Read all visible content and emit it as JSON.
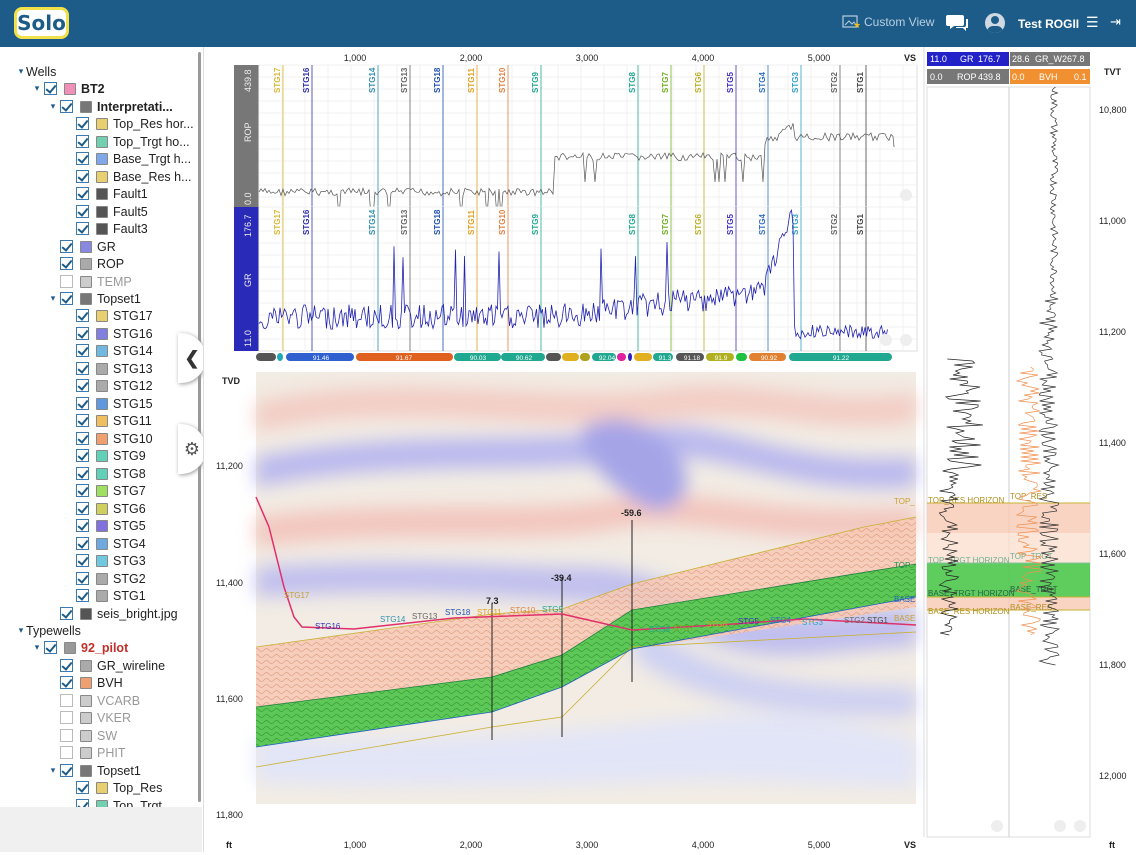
{
  "header": {
    "logo": "Solo",
    "custom_view": "Custom View",
    "user": "Test ROGII"
  },
  "tree": {
    "items": [
      {
        "label": "Wells",
        "level": 0,
        "toggle": "▾",
        "check": "none",
        "color": ""
      },
      {
        "label": "BT2",
        "level": 1,
        "toggle": "▾",
        "check": "on",
        "color": "#f090b8",
        "style": "bold"
      },
      {
        "label": "Interpretati...",
        "level": 2,
        "toggle": "▾",
        "check": "on",
        "color": "#777",
        "style": "bold"
      },
      {
        "label": "Top_Res hor...",
        "level": 3,
        "check": "on",
        "color": "#e8d070"
      },
      {
        "label": "Top_Trgt ho...",
        "level": 3,
        "check": "on",
        "color": "#70d0b0"
      },
      {
        "label": "Base_Trgt h...",
        "level": 3,
        "check": "on",
        "color": "#80a8e8"
      },
      {
        "label": "Base_Res h...",
        "level": 3,
        "check": "on",
        "color": "#e8d070"
      },
      {
        "label": "Fault1",
        "level": 3,
        "check": "on",
        "color": "#555"
      },
      {
        "label": "Fault5",
        "level": 3,
        "check": "on",
        "color": "#555"
      },
      {
        "label": "Fault3",
        "level": 3,
        "check": "on",
        "color": "#555"
      },
      {
        "label": "GR",
        "level": 2,
        "check": "on",
        "color": "#8888e0"
      },
      {
        "label": "ROP",
        "level": 2,
        "check": "on",
        "color": "#aaa"
      },
      {
        "label": "TEMP",
        "level": 2,
        "check": "off",
        "color": "#ccc",
        "style": "grey"
      },
      {
        "label": "Topset1",
        "level": 2,
        "toggle": "▾",
        "check": "on",
        "color": "#777"
      },
      {
        "label": "STG17",
        "level": 3,
        "check": "on",
        "color": "#e8d070"
      },
      {
        "label": "STG16",
        "level": 3,
        "check": "on",
        "color": "#8080e0"
      },
      {
        "label": "STG14",
        "level": 3,
        "check": "on",
        "color": "#70b8e0"
      },
      {
        "label": "STG13",
        "level": 3,
        "check": "on",
        "color": "#aaa"
      },
      {
        "label": "STG12",
        "level": 3,
        "check": "on",
        "color": "#aaa"
      },
      {
        "label": "STG15",
        "level": 3,
        "check": "on",
        "color": "#6098e0"
      },
      {
        "label": "STG11",
        "level": 3,
        "check": "on",
        "color": "#f0c060"
      },
      {
        "label": "STG10",
        "level": 3,
        "check": "on",
        "color": "#f0a070"
      },
      {
        "label": "STG9",
        "level": 3,
        "check": "on",
        "color": "#60d0b8"
      },
      {
        "label": "STG8",
        "level": 3,
        "check": "on",
        "color": "#60d0b8"
      },
      {
        "label": "STG7",
        "level": 3,
        "check": "on",
        "color": "#a0e060"
      },
      {
        "label": "STG6",
        "level": 3,
        "check": "on",
        "color": "#d0d060"
      },
      {
        "label": "STG5",
        "level": 3,
        "check": "on",
        "color": "#8070e0"
      },
      {
        "label": "STG4",
        "level": 3,
        "check": "on",
        "color": "#70a8e0"
      },
      {
        "label": "STG3",
        "level": 3,
        "check": "on",
        "color": "#70c8e0"
      },
      {
        "label": "STG2",
        "level": 3,
        "check": "on",
        "color": "#aaa"
      },
      {
        "label": "STG1",
        "level": 3,
        "check": "on",
        "color": "#aaa"
      },
      {
        "label": "seis_bright.jpg",
        "level": 2,
        "check": "on",
        "color": "#555"
      },
      {
        "label": "Typewells",
        "level": 0,
        "toggle": "▾",
        "check": "none",
        "color": ""
      },
      {
        "label": "92_pilot",
        "level": 1,
        "toggle": "▾",
        "check": "on",
        "color": "#999",
        "style": "red"
      },
      {
        "label": "GR_wireline",
        "level": 2,
        "check": "on",
        "color": "#aaa"
      },
      {
        "label": "BVH",
        "level": 2,
        "check": "on",
        "color": "#f0a070"
      },
      {
        "label": "VCARB",
        "level": 2,
        "check": "off",
        "color": "#ccc",
        "style": "grey"
      },
      {
        "label": "VKER",
        "level": 2,
        "check": "off",
        "color": "#ccc",
        "style": "grey"
      },
      {
        "label": "SW",
        "level": 2,
        "check": "off",
        "color": "#ccc",
        "style": "grey"
      },
      {
        "label": "PHIT",
        "level": 2,
        "check": "off",
        "color": "#ccc",
        "style": "grey"
      },
      {
        "label": "Topset1",
        "level": 2,
        "toggle": "▾",
        "check": "on",
        "color": "#777"
      },
      {
        "label": "Top_Res",
        "level": 3,
        "check": "on",
        "color": "#e8d070"
      },
      {
        "label": "Top_Trgt",
        "level": 3,
        "check": "on",
        "color": "#70d0b0"
      }
    ]
  },
  "vs_axis": {
    "ticks": [
      "1,000",
      "2,000",
      "3,000",
      "4,000",
      "5,000"
    ],
    "unit": "VS"
  },
  "rop": {
    "label": "ROP",
    "max": "439.8",
    "min": "0.0"
  },
  "gr": {
    "label": "GR",
    "max": "176.7",
    "min": "11.0"
  },
  "stages": [
    {
      "name": "STG17",
      "color": "#d8b830"
    },
    {
      "name": "STG16",
      "color": "#3030b0"
    },
    {
      "name": "STG14",
      "color": "#3090b0"
    },
    {
      "name": "STG13",
      "color": "#666"
    },
    {
      "name": "STG18",
      "color": "#2050b0"
    },
    {
      "name": "STG11",
      "color": "#e0a020"
    },
    {
      "name": "STG10",
      "color": "#e08040"
    },
    {
      "name": "STG9",
      "color": "#20a890"
    },
    {
      "name": "STG8",
      "color": "#20a890"
    },
    {
      "name": "STG7",
      "color": "#70b020"
    },
    {
      "name": "STG6",
      "color": "#b8b020"
    },
    {
      "name": "STG5",
      "color": "#4030c0"
    },
    {
      "name": "STG4",
      "color": "#3070c0"
    },
    {
      "name": "STG3",
      "color": "#30a0c8"
    },
    {
      "name": "STG2",
      "color": "#666"
    },
    {
      "name": "STG1",
      "color": "#444"
    }
  ],
  "dip_bar": [
    "91.46",
    "91.67",
    "90.03",
    "90.62",
    "92.04",
    "91.3",
    "91.18",
    "91.9",
    "90.92",
    "91.22"
  ],
  "tvd": {
    "label": "TVD",
    "ticks": [
      "11,200",
      "11,400",
      "11,600",
      "11,800"
    ],
    "unit": "ft"
  },
  "throws": [
    "7.3",
    "-39.4",
    "-59.6"
  ],
  "section_labels": {
    "top": "TOP_",
    "top2": "TOP_",
    "base": "BASE",
    "base2": "BASE",
    "stg17": "STG17"
  },
  "typewell": {
    "gr_label": "GR",
    "gr_max": "176.7",
    "gr_min": "11.0",
    "gr_w_label": "GR_W",
    "gr_w_max": "267.8",
    "gr_w_min": "28.6",
    "rop_label": "ROP",
    "rop_max": "439.8",
    "rop_min": "0.0",
    "bvh_label": "BVH",
    "bvh_max": "",
    "bvh_min": "0.0",
    "bvh_min2": "0.1",
    "tvt_label": "TVT",
    "tvt_ticks": [
      "10,800",
      "11,000",
      "11,200",
      "11,400",
      "11,600",
      "11,800",
      "12,000"
    ],
    "unit": "ft",
    "horizons": [
      "TOP_RES HORIZON",
      "TOP_RES",
      "TOP_TRGT HORIZON",
      "TOP_TRGT",
      "BASE_TRGT HORIZON",
      "BASE_TRGT",
      "BASE_RES HORIZON",
      "BASE_RES"
    ]
  }
}
